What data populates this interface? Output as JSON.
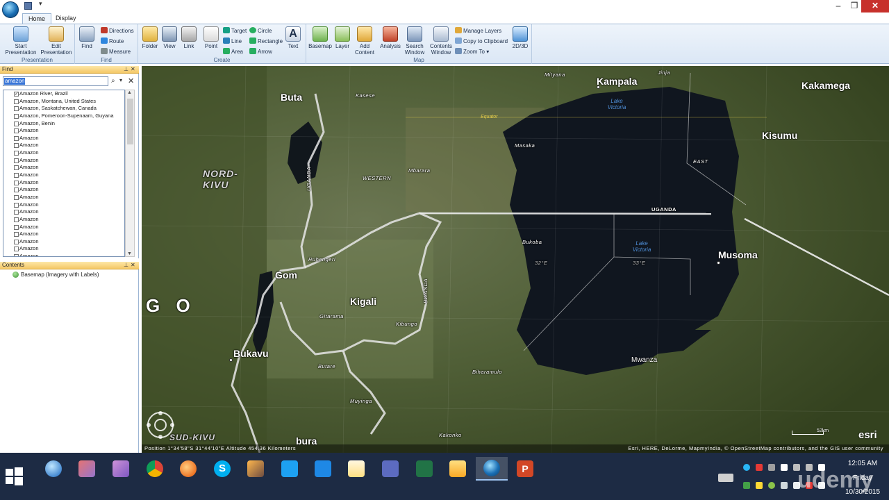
{
  "ribbon": {
    "tabs": [
      {
        "label": "Home"
      },
      {
        "label": "Display"
      }
    ],
    "groups": {
      "presentation": {
        "label": "Presentation",
        "start": "Start Presentation",
        "edit": "Edit Presentation"
      },
      "find": {
        "label": "Find",
        "find": "Find",
        "directions": "Directions",
        "route": "Route",
        "measure": "Measure"
      },
      "create": {
        "label": "Create",
        "folder": "Folder",
        "view": "View",
        "link": "Link",
        "point": "Point",
        "target": "Target",
        "line": "Line",
        "area": "Area",
        "circle": "Circle",
        "rectangle": "Rectangle",
        "arrow": "Arrow",
        "text": "Text"
      },
      "map": {
        "label": "Map",
        "basemap": "Basemap",
        "layer": "Layer",
        "add_content": "Add Content",
        "analysis": "Analysis",
        "search_window": "Search Window",
        "contents_window": "Contents Window",
        "manage_layers": "Manage Layers",
        "copy_clipboard": "Copy to Clipboard",
        "zoom_to": "Zoom To",
        "mode_2d3d": "2D/3D"
      }
    }
  },
  "find_panel": {
    "title": "Find",
    "query": "amazon",
    "results": [
      {
        "label": "Amazon River, Brazil",
        "checked": true
      },
      {
        "label": "Amazon, Montana, United States",
        "checked": false
      },
      {
        "label": "Amazon, Saskatchewan, Canada",
        "checked": false
      },
      {
        "label": "Amazon, Pomeroon-Supenaam, Guyana",
        "checked": false
      },
      {
        "label": "Amazon, Benin",
        "checked": false
      },
      {
        "label": "Amazon",
        "checked": false
      },
      {
        "label": "Amazon",
        "checked": false
      },
      {
        "label": "Amazon",
        "checked": false
      },
      {
        "label": "Amazon",
        "checked": false
      },
      {
        "label": "Amazon",
        "checked": false
      },
      {
        "label": "Amazon",
        "checked": false
      },
      {
        "label": "Amazon",
        "checked": false
      },
      {
        "label": "Amazon",
        "checked": false
      },
      {
        "label": "Amazon",
        "checked": false
      },
      {
        "label": "Amazon",
        "checked": false
      },
      {
        "label": "Amazon",
        "checked": false
      },
      {
        "label": "Amazon",
        "checked": false
      },
      {
        "label": "Amazon",
        "checked": false
      },
      {
        "label": "Amazon",
        "checked": false
      },
      {
        "label": "Amazon",
        "checked": false
      },
      {
        "label": "Amazon",
        "checked": false
      },
      {
        "label": "Amazon",
        "checked": false
      },
      {
        "label": "Amazon",
        "checked": false
      }
    ]
  },
  "contents_panel": {
    "title": "Contents",
    "layers": [
      {
        "label": "Basemap (Imagery with Labels)"
      }
    ]
  },
  "map": {
    "labels": {
      "kampala": "Kampala",
      "kakamega": "Kakamega",
      "kisumu": "Kisumu",
      "musoma": "Musoma",
      "mwanza": "Mwanza",
      "bukavu": "Bukavu",
      "kigali": "Kigali",
      "mityana": "Mityana",
      "jinja": "Jinja",
      "kasese": "Kasese",
      "masaka": "Masaka",
      "mbarara": "Mbarara",
      "bukoba": "Bukoba",
      "ruhengeri": "Ruhengeri",
      "gitarama": "Gitarama",
      "kibungo": "Kibungo",
      "butare": "Butare",
      "muyinga": "Muyinga",
      "biharamulo": "Biharamulo",
      "kakonko": "Kakonko",
      "nord_kivu_1": "NORD-",
      "nord_kivu_2": "KIVU",
      "sud_kivu": "SUD-KIVU",
      "uganda_h": "UGANDA",
      "uganda_v": "UGANDA",
      "rwanda": "RWANDA",
      "western": "WESTERN",
      "east": "EAST",
      "lake_victoria_1": "Lake Victoria",
      "lake_victoria_2": "Lake Victoria",
      "equator": "Equator",
      "lon_32": "32°E",
      "lon_33": "33°E",
      "go": "G O",
      "buta": "Buta",
      "gom": "Gom",
      "bura": "bura"
    },
    "status": {
      "position": "Position 1°34'58\"S 31°44'10\"E Altitude 454.36 Kilometers",
      "attribution": "Esri, HERE, DeLorme, MapmyIndia, © OpenStreetMap contributors, and the GIS user community"
    },
    "scale": "52km",
    "logo": "esri"
  },
  "taskbar": {
    "time": "12:05 AM",
    "day": "Friday",
    "date": "10/30/2015",
    "watermark": "udemy"
  },
  "colors": {
    "accent": "#f4c766",
    "ribbon": "#dbe7f5",
    "taskbar": "#1d2b44"
  }
}
